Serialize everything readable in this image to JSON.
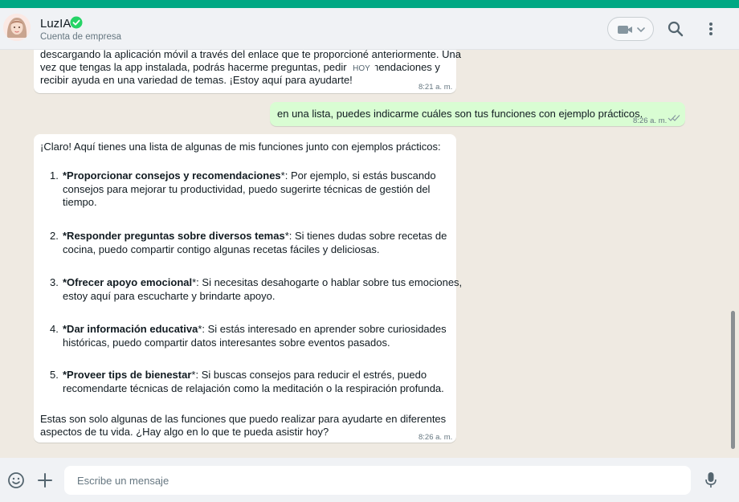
{
  "header": {
    "contact_name": "LuzIA",
    "contact_subtitle": "Cuenta de empresa",
    "icons": [
      "verified-icon",
      "video-camera-icon",
      "chevron-down-icon",
      "search-icon",
      "kebab-menu-icon"
    ]
  },
  "chat": {
    "date_chip": "HOY",
    "messages": [
      {
        "direction": "in",
        "lines": [
          "descargando la aplicación móvil a través del enlace que te proporcioné anteriormente. Una",
          "vez que tengas la app instalada, podrás hacerme preguntas, pedir recomendaciones y",
          "recibir ayuda en una variedad de temas. ¡Estoy aquí para ayudarte!"
        ],
        "time": "8:21 a. m."
      },
      {
        "direction": "out",
        "text": "en una lista, puedes indicarme cuáles son tus funciones con ejemplo prácticos.",
        "time": "8:26 a. m.",
        "status": "read"
      },
      {
        "direction": "in",
        "intro": "¡Claro! Aquí tienes una lista de algunas de mis funciones junto con ejemplos prácticos:",
        "items": [
          {
            "num": "1.",
            "title": "*Proporcionar consejos y recomendaciones",
            "line1": "*: Por ejemplo, si estás buscando",
            "line2": "consejos para mejorar tu productividad, puedo sugerirte técnicas de gestión del",
            "line3": "tiempo."
          },
          {
            "num": "2.",
            "title": "*Responder preguntas sobre diversos temas",
            "line1": "*: Si tienes dudas sobre recetas de",
            "line2": "cocina, puedo compartir contigo algunas recetas fáciles y deliciosas."
          },
          {
            "num": "3.",
            "title": "*Ofrecer apoyo emocional",
            "line1": "*: Si necesitas desahogarte o hablar sobre tus emociones,",
            "line2": "estoy aquí para escucharte y brindarte apoyo."
          },
          {
            "num": "4.",
            "title": "*Dar información educativa",
            "line1": "*: Si estás interesado en aprender sobre curiosidades",
            "line2": "históricas, puedo compartir datos interesantes sobre eventos pasados."
          },
          {
            "num": "5.",
            "title": "*Proveer tips de bienestar",
            "line1": "*: Si buscas consejos para reducir el estrés, puedo",
            "line2": "recomendarte técnicas de relajación como la meditación o la respiración profunda."
          }
        ],
        "outro1": "Estas son solo algunas de las funciones que puedo realizar para ayudarte en diferentes",
        "outro2": "aspectos de tu vida. ¿Hay algo en lo que te pueda asistir hoy?",
        "time": "8:26 a. m."
      }
    ]
  },
  "footer": {
    "input_placeholder": "Escribe un mensaje",
    "input_value": "",
    "icons": [
      "emoji-icon",
      "plus-icon",
      "microphone-icon"
    ]
  },
  "colors": {
    "accent": "#00a884",
    "chat_background": "#efeae2",
    "incoming_bubble": "#ffffff",
    "outgoing_bubble": "#d9fdd3",
    "read_ticks": "#8696a0"
  }
}
